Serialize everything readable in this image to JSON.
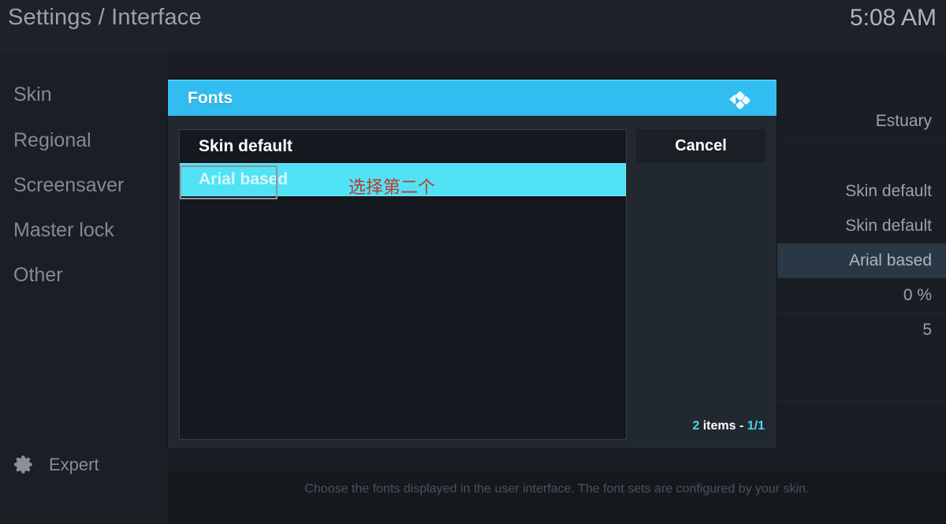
{
  "topbar": {
    "title": "Settings / Interface",
    "clock": "5:08 AM"
  },
  "sidebar": {
    "items": [
      {
        "label": "Skin"
      },
      {
        "label": "Regional"
      },
      {
        "label": "Screensaver"
      },
      {
        "label": "Master lock"
      },
      {
        "label": "Other"
      }
    ],
    "level_button": {
      "label": "Expert",
      "icon": "gear-icon"
    }
  },
  "settings": {
    "values": [
      {
        "value": "Estuary",
        "selected": false
      },
      {
        "value": "Skin default",
        "selected": false
      },
      {
        "value": "Skin default",
        "selected": false
      },
      {
        "value": "Arial based",
        "selected": true
      },
      {
        "value": "0 %",
        "selected": false
      },
      {
        "value": "5",
        "selected": false
      }
    ]
  },
  "help": {
    "text": "Choose the fonts displayed in the user interface. The font sets are configured by your skin."
  },
  "dialog": {
    "title": "Fonts",
    "logo_icon": "kodi-logo-icon",
    "list": [
      {
        "label": "Skin default",
        "focused": false
      },
      {
        "label": "Arial based",
        "focused": true
      }
    ],
    "cancel_label": "Cancel",
    "items_count": {
      "count": "2",
      "middle": " items - ",
      "page": "1/1"
    }
  },
  "annotation": {
    "text": "选择第二个",
    "color": "#c0392b",
    "box_target": "Arial based"
  },
  "colors": {
    "accent": "#31bdef",
    "focus": "#50e3f5",
    "background": "#15171c",
    "panel": "#1a1d23",
    "selected_row": "#2a3744"
  }
}
